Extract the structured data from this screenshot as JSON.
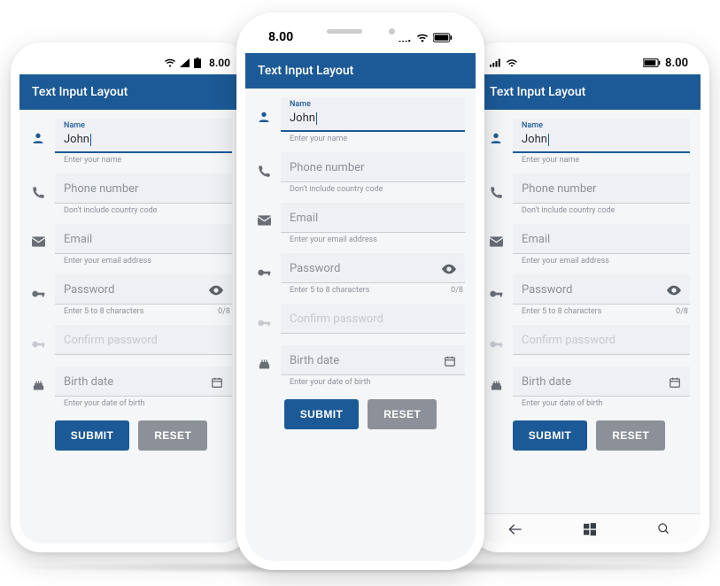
{
  "status": {
    "time": "8.00"
  },
  "app": {
    "title": "Text Input Layout"
  },
  "fields": {
    "name": {
      "label": "Name",
      "value": "John",
      "helper": "Enter your name"
    },
    "phone": {
      "placeholder": "Phone number",
      "helper": "Don't include country code"
    },
    "email": {
      "placeholder": "Email",
      "helper": "Enter your email address"
    },
    "password": {
      "placeholder": "Password",
      "helper": "Enter 5 to 8 characters",
      "counter": "0/8"
    },
    "confirm": {
      "placeholder": "Confirm password"
    },
    "birth": {
      "placeholder": "Birth date",
      "helper": "Enter your date of birth"
    }
  },
  "buttons": {
    "submit": "SUBMIT",
    "reset": "RESET"
  }
}
